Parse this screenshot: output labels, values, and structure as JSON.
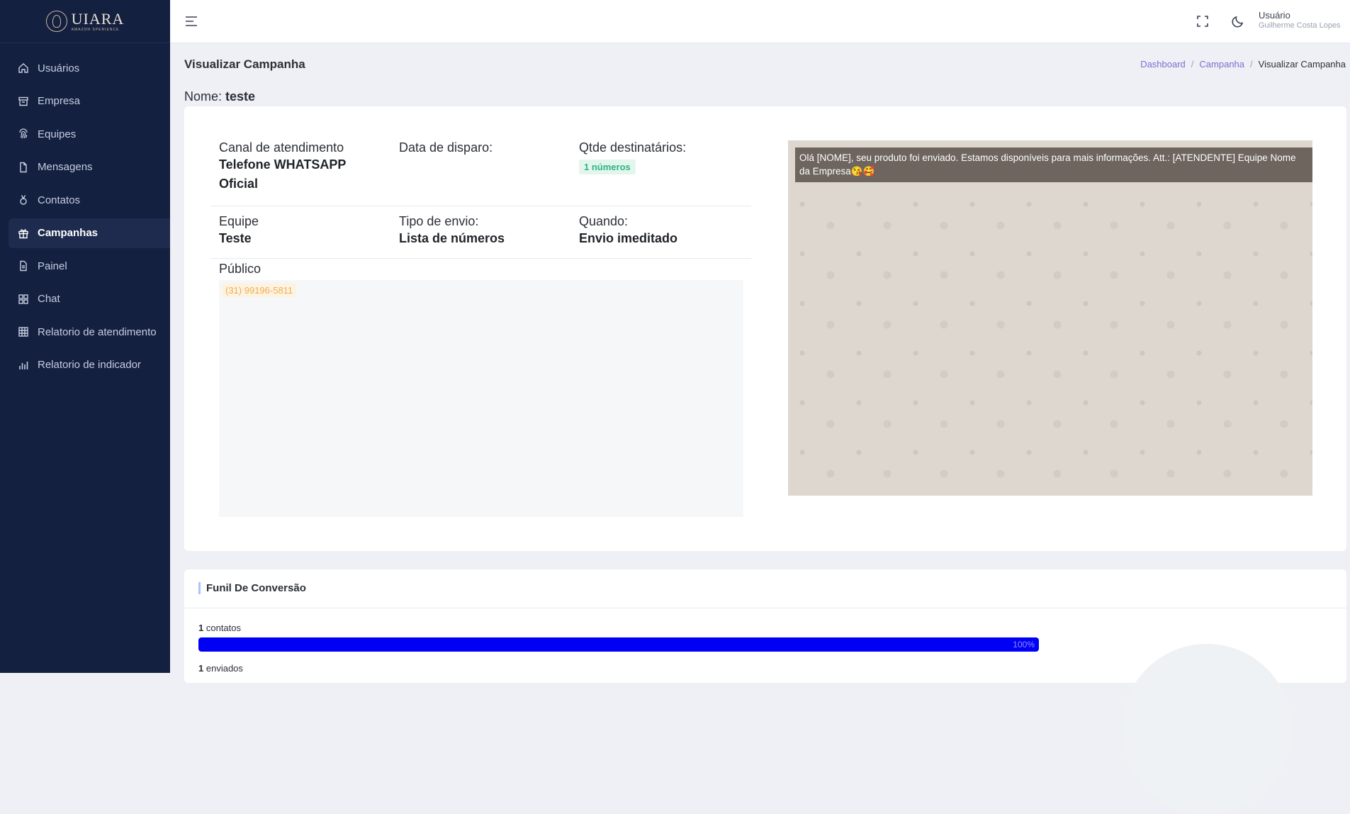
{
  "brand": {
    "logo_main": "UIARA",
    "logo_sub": "AMAZON SPERIENCE"
  },
  "sidebar": {
    "items": [
      {
        "label": "Usuários",
        "icon": "home-icon",
        "active": false
      },
      {
        "label": "Empresa",
        "icon": "archive-icon",
        "active": false
      },
      {
        "label": "Equipes",
        "icon": "fingerprint-icon",
        "active": false
      },
      {
        "label": "Mensagens",
        "icon": "file-icon",
        "active": false
      },
      {
        "label": "Contatos",
        "icon": "medal-icon",
        "active": false
      },
      {
        "label": "Campanhas",
        "icon": "gift-icon",
        "active": true
      },
      {
        "label": "Painel",
        "icon": "document-icon",
        "active": false
      },
      {
        "label": "Chat",
        "icon": "grid-icon",
        "active": false
      },
      {
        "label": "Relatorio de atendimento",
        "icon": "table-icon",
        "active": false
      },
      {
        "label": "Relatorio de indicador",
        "icon": "bar-chart-icon",
        "active": false
      }
    ]
  },
  "topbar": {
    "menu_icon": "hamburger-icon",
    "fullscreen_icon": "fullscreen-icon",
    "theme_icon": "moon-icon",
    "user_title": "Usuário",
    "user_name": "Guilherme Costa Lopes"
  },
  "header": {
    "title": "Visualizar Campanha",
    "breadcrumb": [
      "Dashboard",
      "Campanha",
      "Visualizar Campanha"
    ]
  },
  "campaign": {
    "name_label": "Nome:",
    "name_value": "teste",
    "canal_label": "Canal de atendimento",
    "canal_value": "Telefone WHATSAPP Oficial",
    "data_label": "Data de disparo:",
    "data_value": "",
    "qtde_label": "Qtde destinatários:",
    "qtde_badge": "1 números",
    "equipe_label": "Equipe",
    "equipe_value": "Teste",
    "tipo_label": "Tipo de envio:",
    "tipo_value": "Lista de números",
    "quando_label": "Quando:",
    "quando_value": "Envio imeditado",
    "publico_label": "Público",
    "publico_numbers": [
      "(31) 99196-5811"
    ],
    "message_preview": "Olá [NOME], seu produto foi enviado. Estamos disponíveis para mais informações. Att.: [ATENDENTE] Equipe Nome da Empresa😘🥰"
  },
  "funnel": {
    "title": "Funil De Conversão",
    "stats": [
      {
        "count": "1",
        "label": "contatos",
        "percent_label": "100%",
        "fraction": 1.0
      },
      {
        "count": "1",
        "label": "enviados"
      }
    ]
  },
  "colors": {
    "sidebar_bg": "#14203f",
    "accent": "#7b6fd0",
    "bar": "#0000f5",
    "badge_green": "#2fb383",
    "badge_orange": "#f0ad4e"
  }
}
